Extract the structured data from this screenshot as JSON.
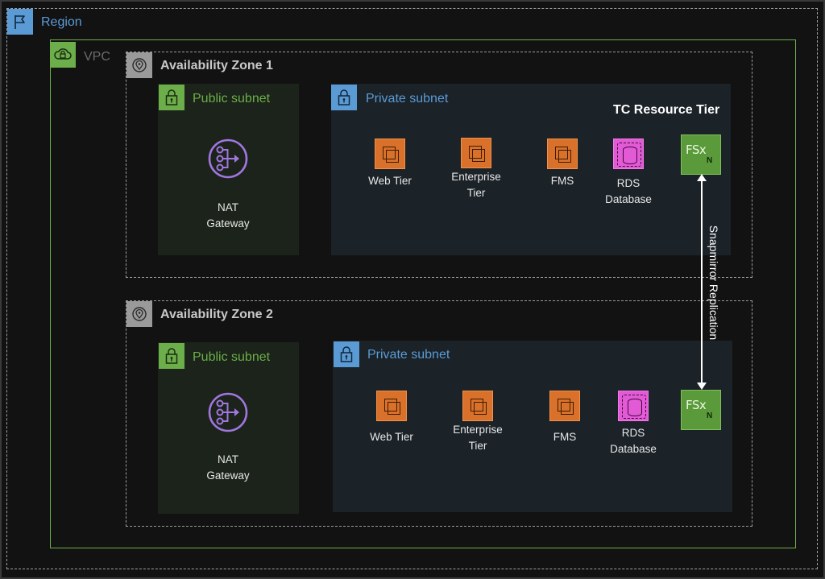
{
  "region": {
    "label": "Region",
    "icon": "flag-icon",
    "color": "#5b9bd5"
  },
  "vpc": {
    "label": "VPC",
    "icon": "cloud-lock-icon",
    "color": "#6cae4a"
  },
  "zones": [
    {
      "label": "Availability Zone 1",
      "public_subnet": {
        "label": "Public subnet",
        "service": [
          "NAT",
          "Gateway"
        ]
      },
      "private_subnet": {
        "label": "Private subnet",
        "tier_title": "TC Resource Tier",
        "services": [
          {
            "lines": [
              "Web Tier"
            ],
            "icon": "ec2-icon"
          },
          {
            "lines": [
              "Enterprise",
              "Tier"
            ],
            "icon": "ec2-icon"
          },
          {
            "lines": [
              "FMS"
            ],
            "icon": "ec2-icon"
          },
          {
            "lines": [
              "RDS",
              "Database"
            ],
            "icon": "rds-icon"
          }
        ],
        "fsx": {
          "icon": "fsx-netapp-icon",
          "text": "FSx"
        }
      }
    },
    {
      "label": "Availability Zone 2",
      "public_subnet": {
        "label": "Public subnet",
        "service": [
          "NAT",
          "Gateway"
        ]
      },
      "private_subnet": {
        "label": "Private subnet",
        "services": [
          {
            "lines": [
              "Web Tier"
            ],
            "icon": "ec2-icon"
          },
          {
            "lines": [
              "Enterprise",
              "Tier"
            ],
            "icon": "ec2-icon"
          },
          {
            "lines": [
              "FMS"
            ],
            "icon": "ec2-icon"
          },
          {
            "lines": [
              "RDS",
              "Database"
            ],
            "icon": "rds-icon"
          }
        ],
        "fsx": {
          "icon": "fsx-netapp-icon",
          "text": "FSx"
        }
      }
    }
  ],
  "replication": {
    "label": "Snapmirror Replication"
  },
  "colors": {
    "public_subnet": "#6cae4a",
    "private_subnet": "#5b9bd5",
    "ec2": "#d9712b",
    "rds": "#e25ad6",
    "nat": "#a176e0",
    "fsx": "#5a9a3a"
  }
}
